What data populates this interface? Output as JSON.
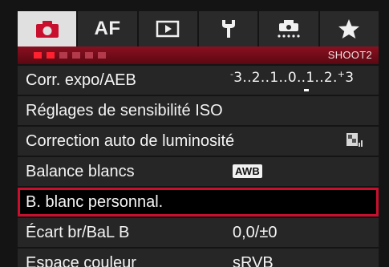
{
  "tabs": [
    {
      "name": "shooting",
      "icon": "camera-icon",
      "active": true
    },
    {
      "name": "af",
      "label": "AF"
    },
    {
      "name": "playback",
      "icon": "play-icon"
    },
    {
      "name": "setup",
      "icon": "wrench-icon"
    },
    {
      "name": "custom-functions",
      "icon": "custom-camera-icon"
    },
    {
      "name": "my-menu",
      "icon": "star-icon"
    }
  ],
  "page_indicator": {
    "pages": 6,
    "active_pages": 2,
    "label": "SHOOT2"
  },
  "colors": {
    "accent": "#c8102e",
    "row_bg": "#262626",
    "subbar": "#8a1020"
  },
  "menu": {
    "items": [
      {
        "label": "Corr. expo/AEB",
        "scale": {
          "ticks": "3..2..1..0..1..2.",
          "left_sign": "-",
          "right_sign": "+",
          "right_end": "3"
        }
      },
      {
        "label": "Réglages de sensibilité ISO"
      },
      {
        "label": "Correction auto de luminosité",
        "icon": "auto-lighting-optimizer-icon"
      },
      {
        "label": "Balance blancs",
        "badge": "AWB"
      },
      {
        "label": "B. blanc personnal.",
        "selected": true
      },
      {
        "label": "Écart br/BaL B",
        "value": "0,0/±0"
      },
      {
        "label": "Espace couleur",
        "value": "sRVB"
      }
    ]
  }
}
